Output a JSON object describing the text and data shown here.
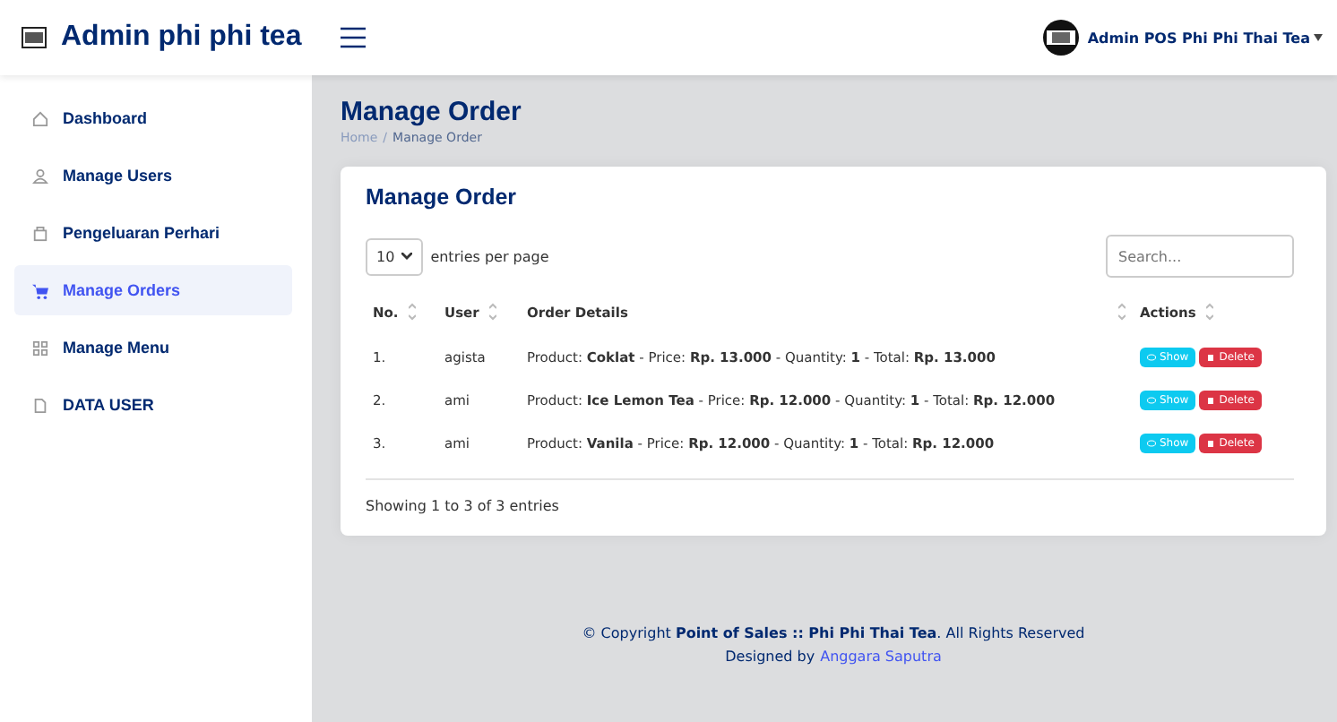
{
  "header": {
    "brand": "Admin phi phi tea",
    "user": "Admin POS Phi Phi Thai Tea"
  },
  "sidebar": {
    "items": [
      {
        "label": "Dashboard",
        "selected": false
      },
      {
        "label": "Manage Users",
        "selected": false
      },
      {
        "label": "Pengeluaran Perhari",
        "selected": false
      },
      {
        "label": "Manage Orders",
        "selected": true
      },
      {
        "label": "Manage Menu",
        "selected": false
      },
      {
        "label": "DATA USER",
        "selected": false
      }
    ]
  },
  "page": {
    "title": "Manage Order",
    "breadcrumb": [
      "Home",
      "Manage Order"
    ],
    "breadcrumb_separator": "/"
  },
  "card": {
    "title": "Manage Order",
    "per_page": "10",
    "per_page_label": "entries per page",
    "search_placeholder": "Search...",
    "columns": [
      {
        "label": "No.",
        "sortable": true
      },
      {
        "label": "User",
        "sortable": true
      },
      {
        "label": "Order Details",
        "sortable": true
      },
      {
        "label": "Actions",
        "sortable": true
      }
    ],
    "rows": [
      {
        "no": "1.",
        "user": "agista",
        "details": "Product: **Coklat** - Price: **Rp. 13.000** - Quantity: **1** - Total: **Rp. 13.000**",
        "actions": [
          "Show",
          "Delete"
        ]
      },
      {
        "no": "2.",
        "user": "ami",
        "details": "Product: **Ice Lemon Tea** - Price: **Rp. 12.000** - Quantity: **1** - Total: **Rp. 12.000**",
        "actions": [
          "Show",
          "Delete"
        ]
      },
      {
        "no": "3.",
        "user": "ami",
        "details": "Product: **Vanila** - Price: **Rp. 12.000** - Quantity: **1** - Total: **Rp. 12.000**",
        "actions": [
          "Show",
          "Delete"
        ]
      }
    ],
    "info": "Showing 1 to 3 of 3 entries"
  },
  "footer": {
    "copyright": "© Copyright **Point of Sales :: Phi Phi Thai Tea**. All Rights Reserved",
    "designed_by": "Designed by",
    "designer": "Anggara Saputra"
  }
}
